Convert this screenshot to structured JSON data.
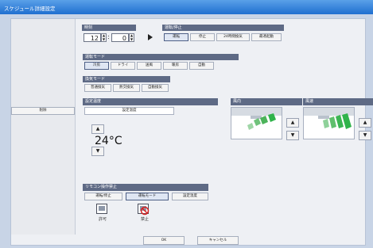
{
  "window": {
    "title": "スケジュール詳細設定"
  },
  "left_panel": {
    "delete_label": "削除"
  },
  "time": {
    "label": "時刻",
    "hour": "12",
    "minute": "0",
    "separator": ":"
  },
  "run_stop": {
    "label": "運転/停止",
    "options": [
      "運転",
      "停止",
      "24時間換気",
      "最適起動"
    ]
  },
  "operation_mode": {
    "label": "運転モード",
    "options": [
      "冷房",
      "ドライ",
      "送風",
      "暖房",
      "自動"
    ]
  },
  "ventilation_mode": {
    "label": "換気モード",
    "options": [
      "普通換気",
      "熱交換気",
      "自動換気"
    ]
  },
  "set_temp": {
    "label": "設定温度",
    "column_header": "設定温度",
    "value": "24°C"
  },
  "wind_direction": {
    "label": "風向"
  },
  "wind_speed": {
    "label": "風速"
  },
  "remote_prohibit": {
    "label": "リモコン操作禁止",
    "options": [
      "運転/停止",
      "運転モード",
      "設定温度"
    ],
    "allow_label": "許可",
    "prohibit_label": "禁止"
  },
  "footer": {
    "ok_label": "OK",
    "cancel_label": "キャンセル"
  },
  "colors": {
    "title_bar": "#2f7fdc",
    "section_bar": "#5e6a85",
    "accent_green": "#2fb34a",
    "prohibit_red": "#d62020"
  },
  "icons": [
    "up-arrow-icon",
    "down-arrow-icon",
    "play-arrow-icon",
    "louver-icon",
    "fan-speed-icon",
    "remote-allow-icon",
    "remote-prohibit-icon"
  ]
}
